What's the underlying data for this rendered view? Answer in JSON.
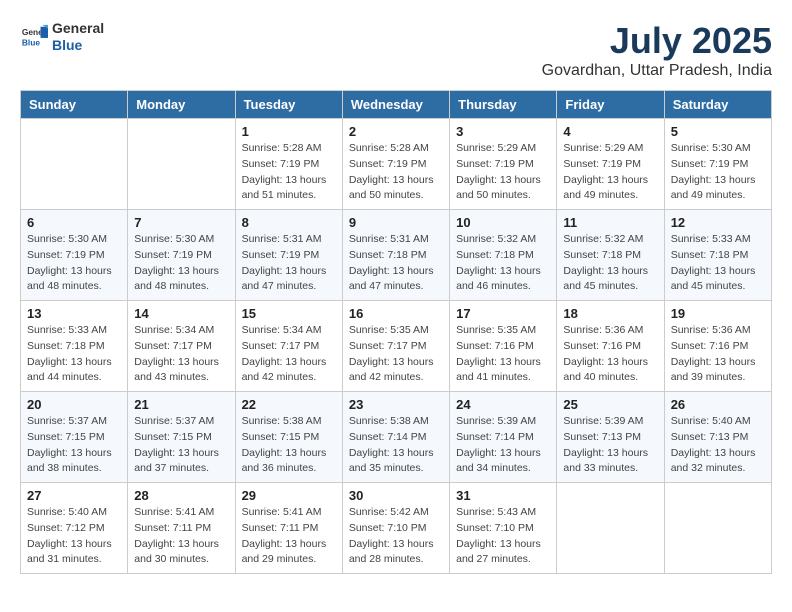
{
  "header": {
    "logo_general": "General",
    "logo_blue": "Blue",
    "month_title": "July 2025",
    "subtitle": "Govardhan, Uttar Pradesh, India"
  },
  "weekdays": [
    "Sunday",
    "Monday",
    "Tuesday",
    "Wednesday",
    "Thursday",
    "Friday",
    "Saturday"
  ],
  "weeks": [
    [
      {
        "day": "",
        "info": ""
      },
      {
        "day": "",
        "info": ""
      },
      {
        "day": "1",
        "info": "Sunrise: 5:28 AM\nSunset: 7:19 PM\nDaylight: 13 hours and 51 minutes."
      },
      {
        "day": "2",
        "info": "Sunrise: 5:28 AM\nSunset: 7:19 PM\nDaylight: 13 hours and 50 minutes."
      },
      {
        "day": "3",
        "info": "Sunrise: 5:29 AM\nSunset: 7:19 PM\nDaylight: 13 hours and 50 minutes."
      },
      {
        "day": "4",
        "info": "Sunrise: 5:29 AM\nSunset: 7:19 PM\nDaylight: 13 hours and 49 minutes."
      },
      {
        "day": "5",
        "info": "Sunrise: 5:30 AM\nSunset: 7:19 PM\nDaylight: 13 hours and 49 minutes."
      }
    ],
    [
      {
        "day": "6",
        "info": "Sunrise: 5:30 AM\nSunset: 7:19 PM\nDaylight: 13 hours and 48 minutes."
      },
      {
        "day": "7",
        "info": "Sunrise: 5:30 AM\nSunset: 7:19 PM\nDaylight: 13 hours and 48 minutes."
      },
      {
        "day": "8",
        "info": "Sunrise: 5:31 AM\nSunset: 7:19 PM\nDaylight: 13 hours and 47 minutes."
      },
      {
        "day": "9",
        "info": "Sunrise: 5:31 AM\nSunset: 7:18 PM\nDaylight: 13 hours and 47 minutes."
      },
      {
        "day": "10",
        "info": "Sunrise: 5:32 AM\nSunset: 7:18 PM\nDaylight: 13 hours and 46 minutes."
      },
      {
        "day": "11",
        "info": "Sunrise: 5:32 AM\nSunset: 7:18 PM\nDaylight: 13 hours and 45 minutes."
      },
      {
        "day": "12",
        "info": "Sunrise: 5:33 AM\nSunset: 7:18 PM\nDaylight: 13 hours and 45 minutes."
      }
    ],
    [
      {
        "day": "13",
        "info": "Sunrise: 5:33 AM\nSunset: 7:18 PM\nDaylight: 13 hours and 44 minutes."
      },
      {
        "day": "14",
        "info": "Sunrise: 5:34 AM\nSunset: 7:17 PM\nDaylight: 13 hours and 43 minutes."
      },
      {
        "day": "15",
        "info": "Sunrise: 5:34 AM\nSunset: 7:17 PM\nDaylight: 13 hours and 42 minutes."
      },
      {
        "day": "16",
        "info": "Sunrise: 5:35 AM\nSunset: 7:17 PM\nDaylight: 13 hours and 42 minutes."
      },
      {
        "day": "17",
        "info": "Sunrise: 5:35 AM\nSunset: 7:16 PM\nDaylight: 13 hours and 41 minutes."
      },
      {
        "day": "18",
        "info": "Sunrise: 5:36 AM\nSunset: 7:16 PM\nDaylight: 13 hours and 40 minutes."
      },
      {
        "day": "19",
        "info": "Sunrise: 5:36 AM\nSunset: 7:16 PM\nDaylight: 13 hours and 39 minutes."
      }
    ],
    [
      {
        "day": "20",
        "info": "Sunrise: 5:37 AM\nSunset: 7:15 PM\nDaylight: 13 hours and 38 minutes."
      },
      {
        "day": "21",
        "info": "Sunrise: 5:37 AM\nSunset: 7:15 PM\nDaylight: 13 hours and 37 minutes."
      },
      {
        "day": "22",
        "info": "Sunrise: 5:38 AM\nSunset: 7:15 PM\nDaylight: 13 hours and 36 minutes."
      },
      {
        "day": "23",
        "info": "Sunrise: 5:38 AM\nSunset: 7:14 PM\nDaylight: 13 hours and 35 minutes."
      },
      {
        "day": "24",
        "info": "Sunrise: 5:39 AM\nSunset: 7:14 PM\nDaylight: 13 hours and 34 minutes."
      },
      {
        "day": "25",
        "info": "Sunrise: 5:39 AM\nSunset: 7:13 PM\nDaylight: 13 hours and 33 minutes."
      },
      {
        "day": "26",
        "info": "Sunrise: 5:40 AM\nSunset: 7:13 PM\nDaylight: 13 hours and 32 minutes."
      }
    ],
    [
      {
        "day": "27",
        "info": "Sunrise: 5:40 AM\nSunset: 7:12 PM\nDaylight: 13 hours and 31 minutes."
      },
      {
        "day": "28",
        "info": "Sunrise: 5:41 AM\nSunset: 7:11 PM\nDaylight: 13 hours and 30 minutes."
      },
      {
        "day": "29",
        "info": "Sunrise: 5:41 AM\nSunset: 7:11 PM\nDaylight: 13 hours and 29 minutes."
      },
      {
        "day": "30",
        "info": "Sunrise: 5:42 AM\nSunset: 7:10 PM\nDaylight: 13 hours and 28 minutes."
      },
      {
        "day": "31",
        "info": "Sunrise: 5:43 AM\nSunset: 7:10 PM\nDaylight: 13 hours and 27 minutes."
      },
      {
        "day": "",
        "info": ""
      },
      {
        "day": "",
        "info": ""
      }
    ]
  ]
}
